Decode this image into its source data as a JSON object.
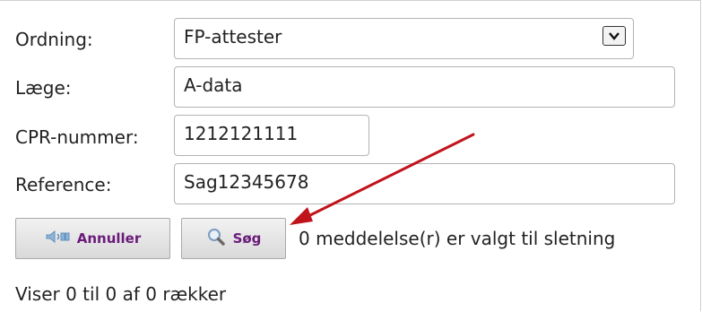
{
  "form": {
    "ordning": {
      "label": "Ordning:",
      "value": "FP-attester"
    },
    "laege": {
      "label": "Læge:",
      "value": "A-data"
    },
    "cpr": {
      "label": "CPR-nummer:",
      "value": "1212121111"
    },
    "reference": {
      "label": "Reference:",
      "value": "Sag12345678"
    }
  },
  "buttons": {
    "cancel": {
      "label": "Annuller",
      "icon": "cancel-speaker-icon"
    },
    "search": {
      "label": "Søg",
      "icon": "magnifier-icon"
    }
  },
  "status": {
    "selected_message": "0 meddelelse(r) er valgt til sletning",
    "rows_info": "Viser 0 til 0 af 0 rækker"
  },
  "annotation": {
    "arrow_color": "#c0141b"
  }
}
